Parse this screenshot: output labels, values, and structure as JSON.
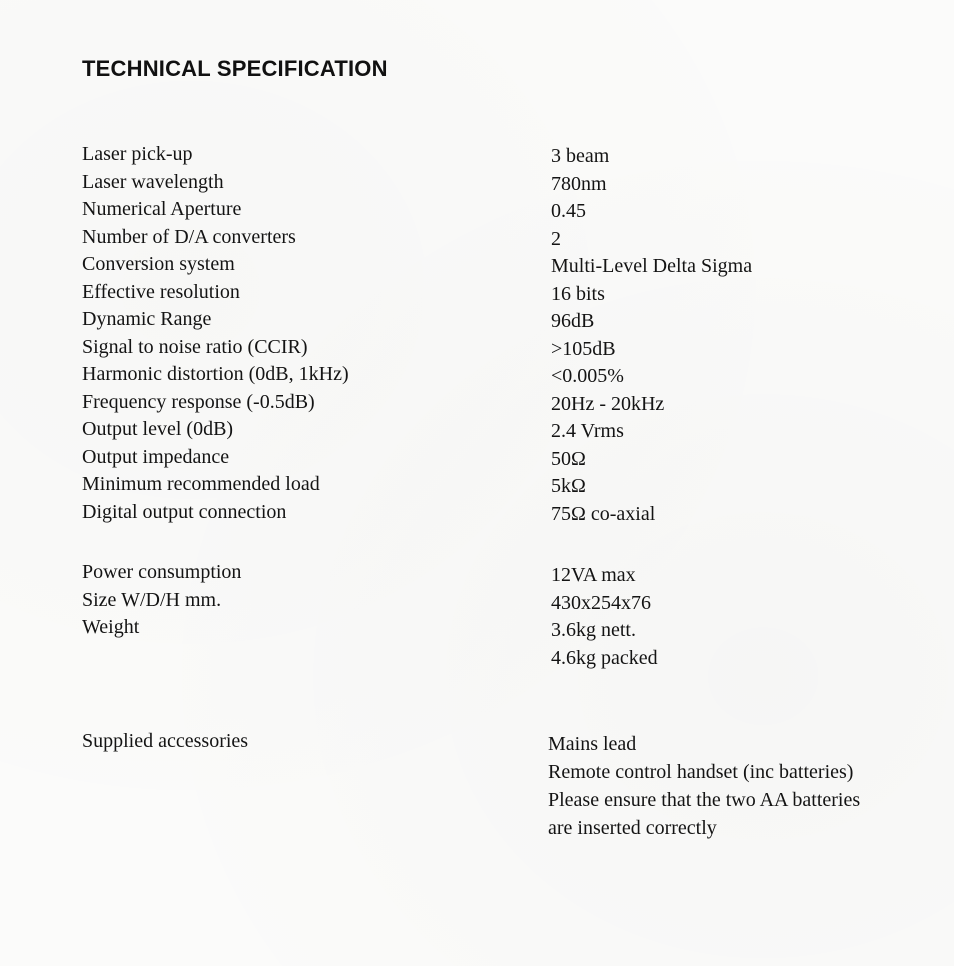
{
  "document": {
    "title": "TECHNICAL SPECIFICATION",
    "specs_primary": [
      {
        "label": "Laser pick-up",
        "value": "3 beam"
      },
      {
        "label": "Laser wavelength",
        "value": "780nm"
      },
      {
        "label": "Numerical Aperture",
        "value": "0.45"
      },
      {
        "label": "Number of D/A converters",
        "value": "2"
      },
      {
        "label": "Conversion system",
        "value": "Multi-Level  Delta Sigma"
      },
      {
        "label": "Effective resolution",
        "value": "16 bits"
      },
      {
        "label": "Dynamic Range",
        "value": "96dB"
      },
      {
        "label": "Signal to noise ratio (CCIR)",
        "value": ">105dB"
      },
      {
        "label": "Harmonic distortion (0dB, 1kHz)",
        "value": "<0.005%"
      },
      {
        "label": "Frequency response (-0.5dB)",
        "value": "20Hz - 20kHz"
      },
      {
        "label": "Output level (0dB)",
        "value": "2.4 Vrms"
      },
      {
        "label": "Output impedance",
        "value": "50Ω"
      },
      {
        "label": "Minimum recommended load",
        "value": "5kΩ"
      },
      {
        "label": "Digital output connection",
        "value": "75Ω co-axial"
      }
    ],
    "specs_physical": {
      "labels": [
        "Power consumption",
        "Size W/D/H mm.",
        "Weight"
      ],
      "values": [
        "12VA max",
        "430x254x76",
        "3.6kg nett.",
        "4.6kg packed"
      ]
    },
    "accessories": {
      "label": "Supplied accessories",
      "lines": [
        "Mains lead",
        "Remote control handset (inc batteries)",
        "Please ensure that the two AA batteries",
        "are inserted correctly"
      ]
    }
  }
}
